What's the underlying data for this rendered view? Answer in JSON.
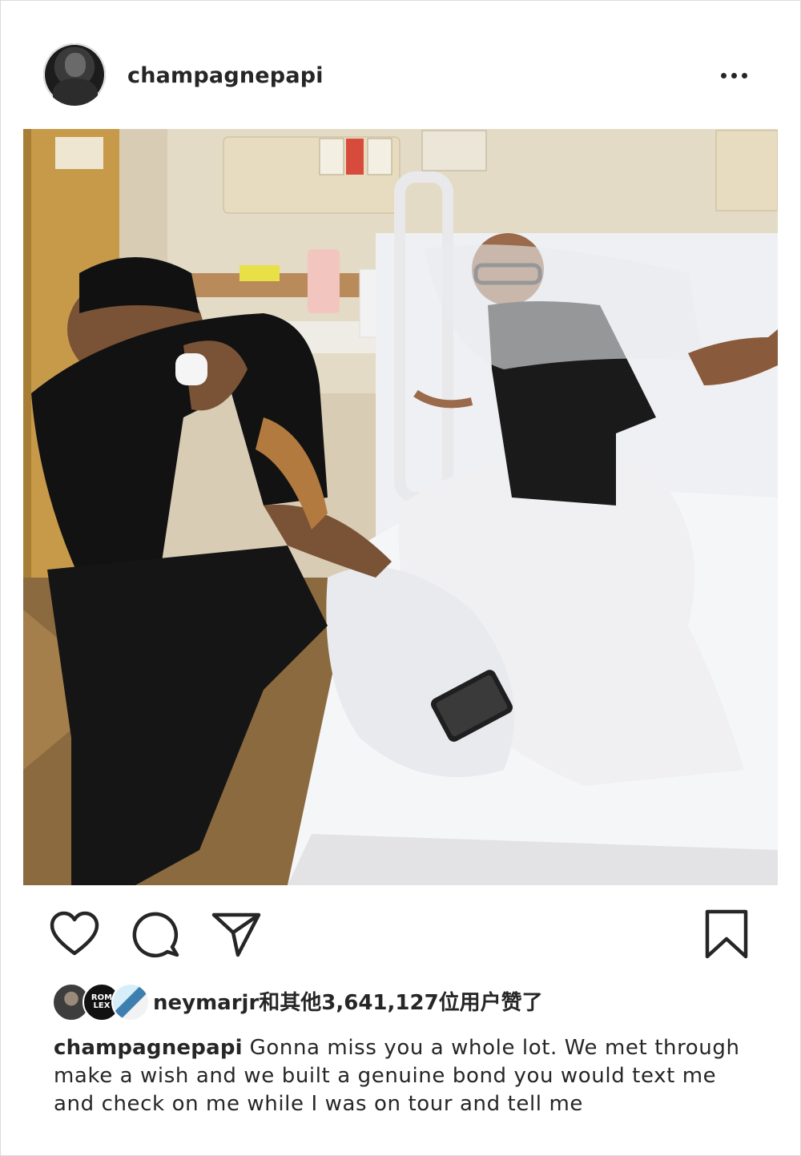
{
  "post": {
    "username": "champagnepapi",
    "photo_alt": "Hospital room photo",
    "likes": {
      "text": "neymarjr和其他3,641,127位用户赞了",
      "avatar_2_text": "ROM LEX"
    },
    "caption": {
      "username": "champagnepapi",
      "text": "Gonna miss you a whole lot. We met through make a wish and we built a genuine bond you would text me and check on me while I was on tour and tell me"
    }
  },
  "icons": {
    "more": "more-options-icon",
    "like": "heart-icon",
    "comment": "comment-icon",
    "share": "share-icon",
    "save": "bookmark-icon"
  },
  "colors": {
    "text": "#262626",
    "border": "#dbdbdb",
    "background": "#ffffff"
  }
}
